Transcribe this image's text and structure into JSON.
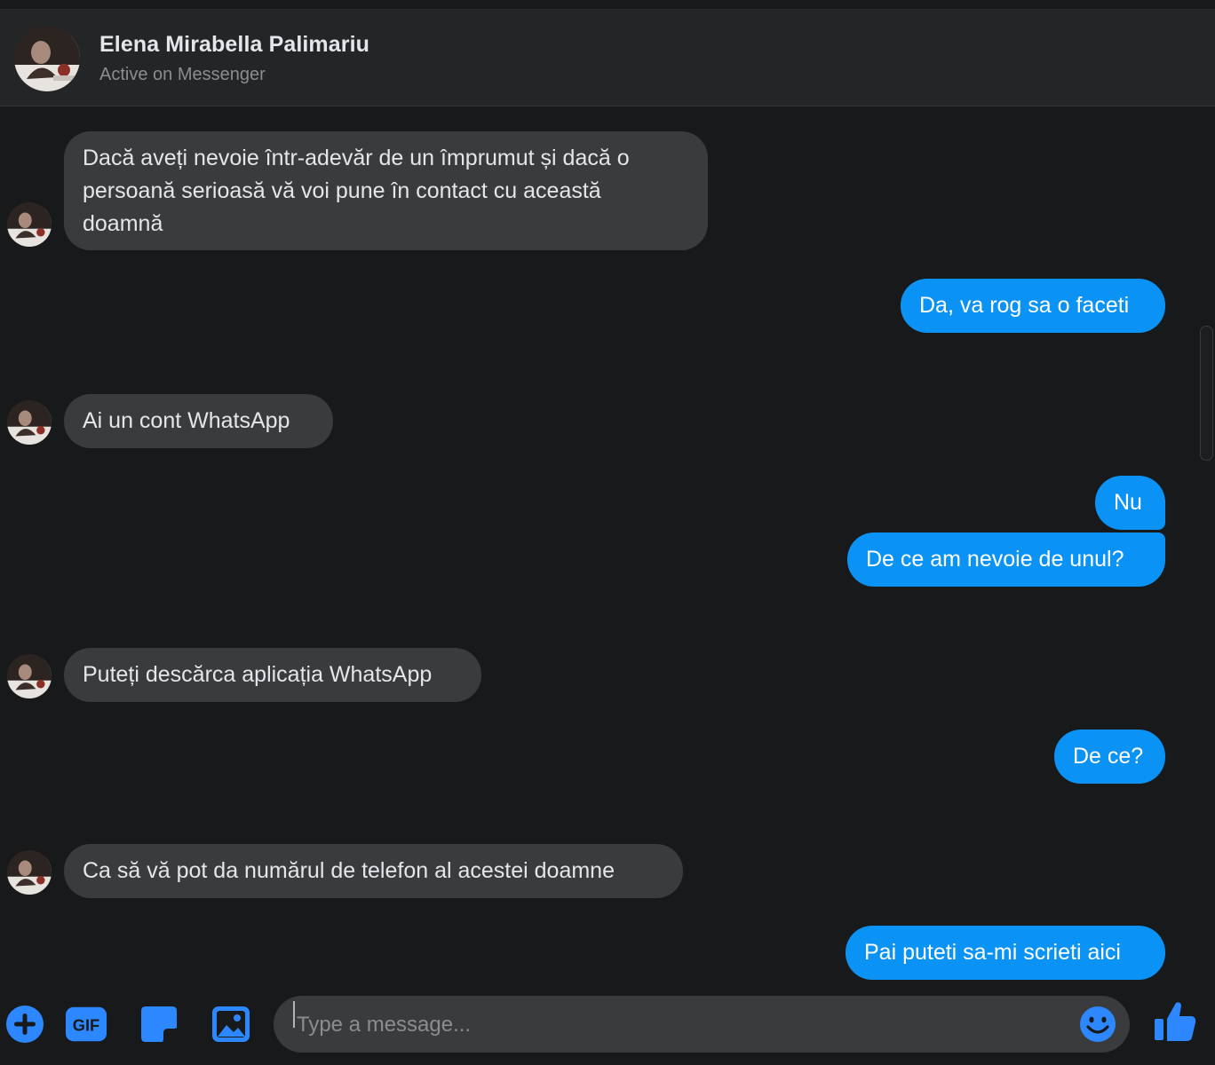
{
  "header": {
    "title": "Elena Mirabella Palimariu",
    "status": "Active on Messenger"
  },
  "messages": [
    {
      "side": "in",
      "text": "Dacă aveți nevoie într-adevăr de un împrumut și dacă o",
      "text2": "persoană serioasă vă voi pune în contact cu această",
      "text3": "doamnă"
    },
    {
      "side": "out",
      "text": "Da, va rog sa o faceti"
    },
    {
      "side": "in",
      "text": "Ai un cont WhatsApp"
    },
    {
      "side": "out",
      "text": "Nu"
    },
    {
      "side": "out",
      "text": "De ce am nevoie de unul?"
    },
    {
      "side": "in",
      "text": "Puteți descărca aplicația WhatsApp"
    },
    {
      "side": "out",
      "text": "De ce?"
    },
    {
      "side": "in",
      "text": "Ca să vă pot da numărul de telefon al acestei doamne"
    },
    {
      "side": "out",
      "text": "Pai puteti sa-mi scrieti aici"
    }
  ],
  "composer": {
    "placeholder": "Type a message...",
    "value": "",
    "icons": [
      "plus-icon",
      "gif-icon",
      "sticker-icon",
      "image-icon",
      "emoji-icon",
      "thumbs-up-icon"
    ]
  },
  "colors": {
    "background": "#18191a",
    "header": "#242526",
    "incoming_bubble": "#3a3b3c",
    "outgoing_bubble": "#0a93f5",
    "accent": "#2d88ff"
  }
}
